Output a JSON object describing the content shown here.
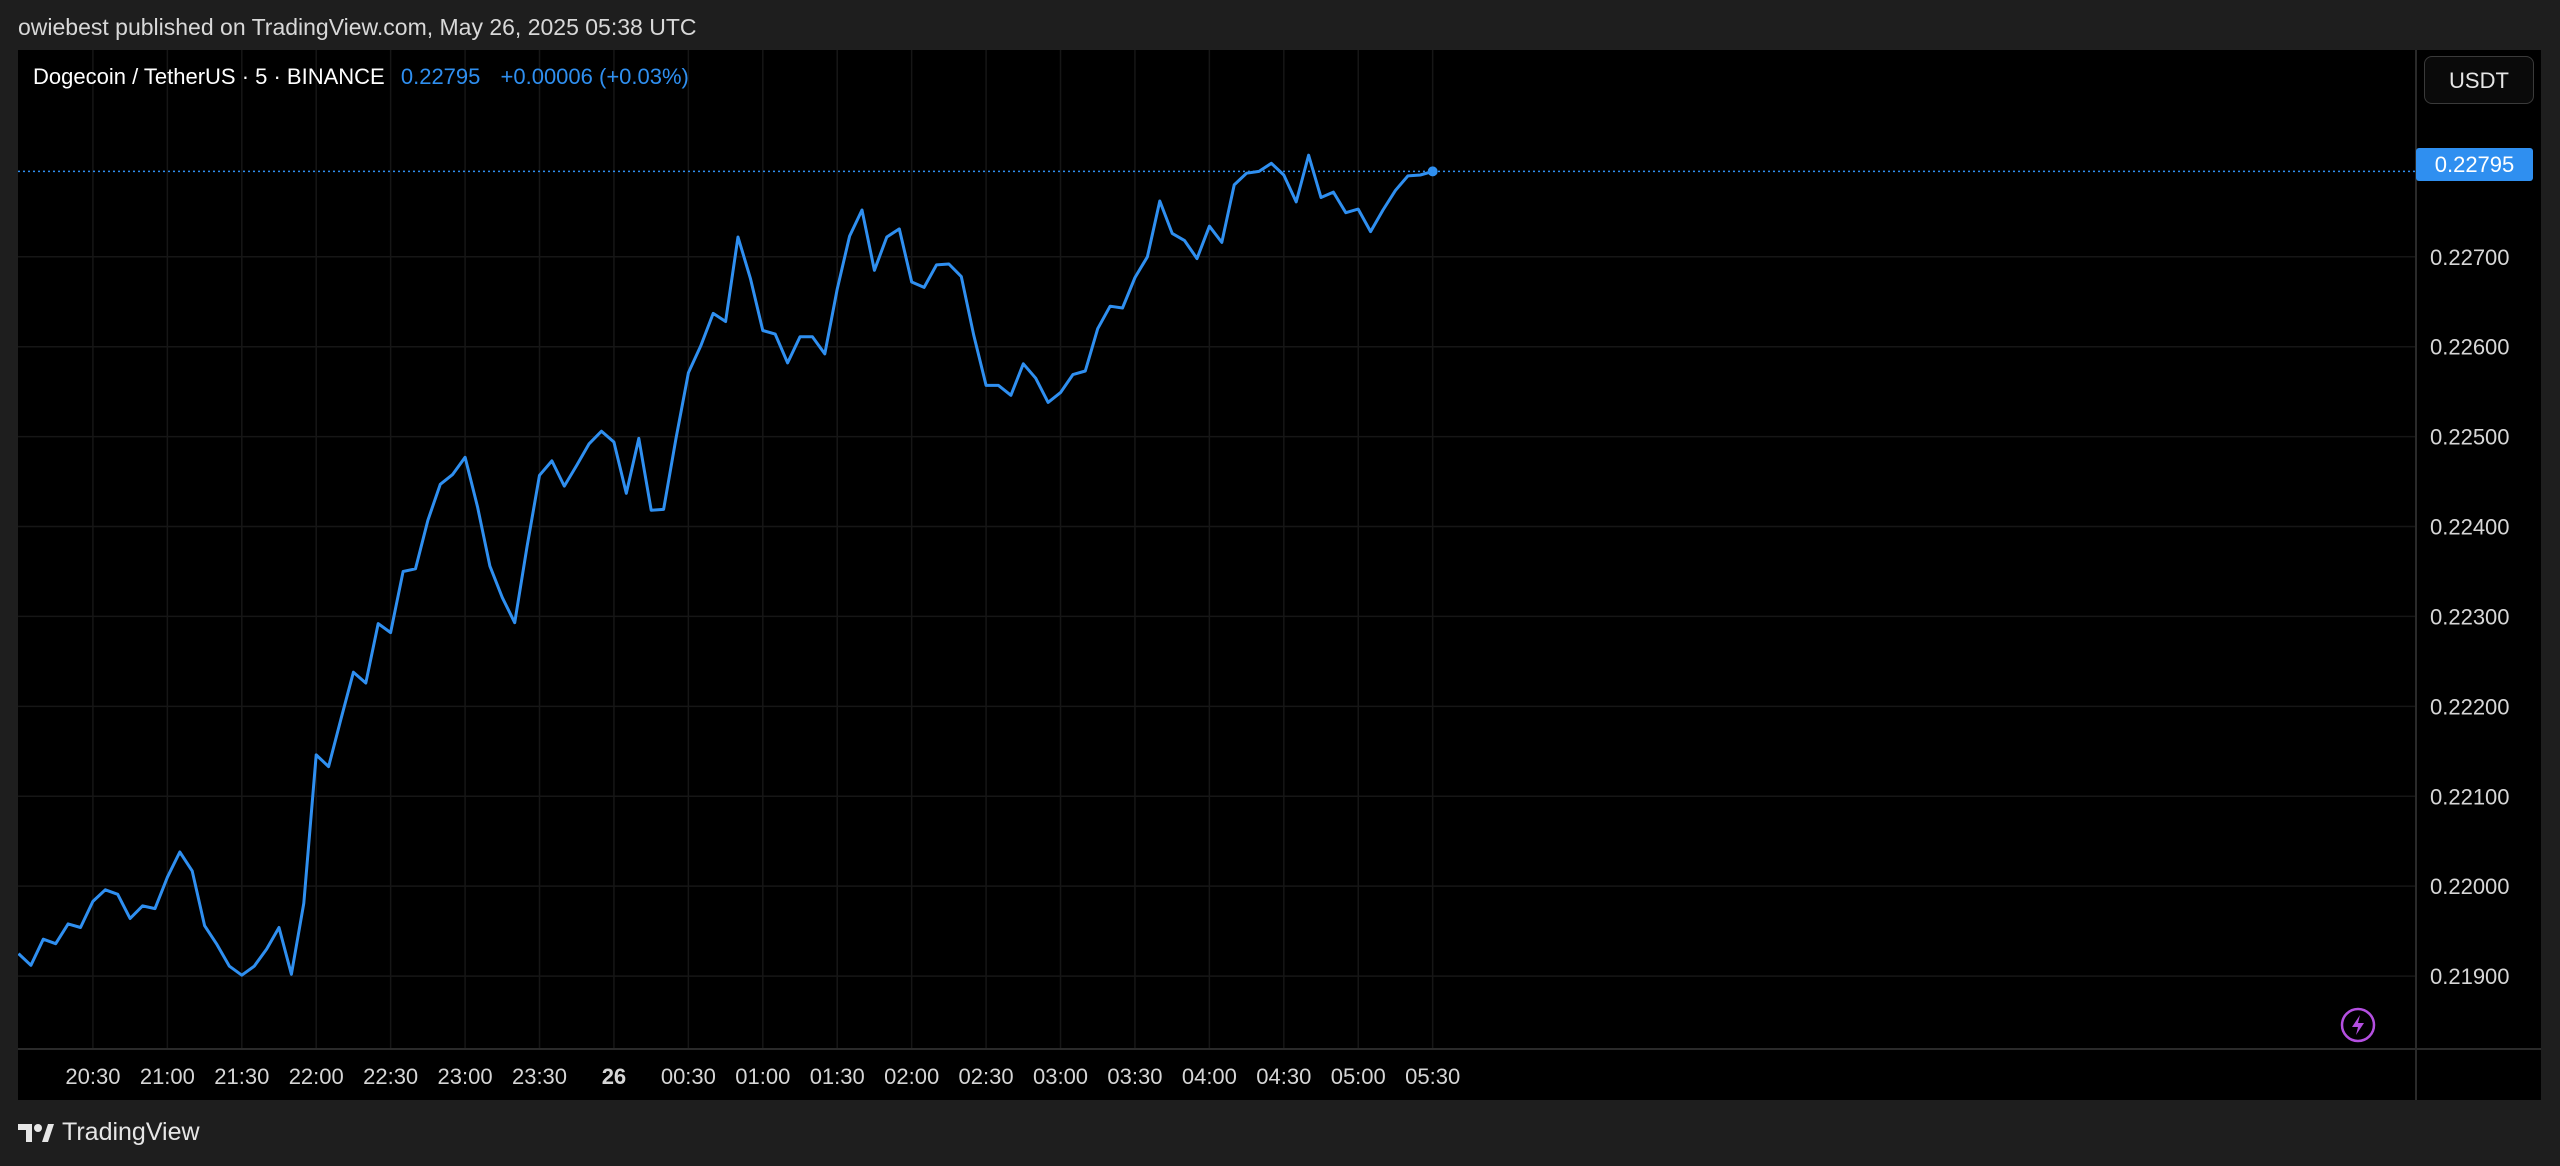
{
  "header": {
    "published_text": "owiebest published on TradingView.com, May 26, 2025 05:38 UTC"
  },
  "legend": {
    "symbol": "Dogecoin / TetherUS · 5 · BINANCE",
    "price": "0.22795",
    "change": "+0.00006 (+0.03%)"
  },
  "currency_button": {
    "label": "USDT"
  },
  "last_price_tag": {
    "label": "0.22795"
  },
  "footer": {
    "brand": "TradingView"
  },
  "colors": {
    "line": "#2f8ff0",
    "background": "#000000",
    "grid": "#161616",
    "axis_text": "#d6d6d6"
  },
  "chart_data": {
    "type": "line",
    "title": "",
    "xlabel": "",
    "ylabel": "",
    "ylim": [
      0.2182,
      0.2293
    ],
    "x_start": "20:00",
    "x_interval_minutes": 5,
    "x_ticks": [
      {
        "label": "20:30",
        "t": 30
      },
      {
        "label": "21:00",
        "t": 60
      },
      {
        "label": "21:30",
        "t": 90
      },
      {
        "label": "22:00",
        "t": 120
      },
      {
        "label": "22:30",
        "t": 150
      },
      {
        "label": "23:00",
        "t": 180
      },
      {
        "label": "23:30",
        "t": 210
      },
      {
        "label": "26",
        "t": 240,
        "bold": true
      },
      {
        "label": "00:30",
        "t": 270
      },
      {
        "label": "01:00",
        "t": 300
      },
      {
        "label": "01:30",
        "t": 330
      },
      {
        "label": "02:00",
        "t": 360
      },
      {
        "label": "02:30",
        "t": 390
      },
      {
        "label": "03:00",
        "t": 420
      },
      {
        "label": "03:30",
        "t": 450
      },
      {
        "label": "04:00",
        "t": 480
      },
      {
        "label": "04:30",
        "t": 510
      },
      {
        "label": "05:00",
        "t": 540
      },
      {
        "label": "05:30",
        "t": 570
      }
    ],
    "y_ticks": [
      "0.22700",
      "0.22600",
      "0.22500",
      "0.22400",
      "0.22300",
      "0.22200",
      "0.22100",
      "0.22000",
      "0.21900"
    ],
    "last_price": 0.22795,
    "series": [
      {
        "name": "",
        "values": [
          0.21925,
          0.21912,
          0.21941,
          0.21936,
          0.21958,
          0.21954,
          0.21983,
          0.21996,
          0.21991,
          0.21964,
          0.21978,
          0.21975,
          0.2201,
          0.22038,
          0.22017,
          0.21956,
          0.21935,
          0.21911,
          0.21901,
          0.21911,
          0.2193,
          0.21954,
          0.21902,
          0.21981,
          0.22146,
          0.22133,
          0.22186,
          0.22238,
          0.22226,
          0.22292,
          0.22282,
          0.2235,
          0.22353,
          0.22407,
          0.22447,
          0.22458,
          0.22477,
          0.22422,
          0.22356,
          0.22321,
          0.22293,
          0.22378,
          0.22457,
          0.22473,
          0.22445,
          0.22468,
          0.22492,
          0.22506,
          0.22494,
          0.22437,
          0.22498,
          0.22418,
          0.22419,
          0.22498,
          0.22571,
          0.22601,
          0.22637,
          0.22628,
          0.22722,
          0.22676,
          0.22618,
          0.22614,
          0.22582,
          0.22611,
          0.22611,
          0.22592,
          0.22664,
          0.22723,
          0.22752,
          0.22685,
          0.22722,
          0.22731,
          0.22672,
          0.22666,
          0.22691,
          0.22692,
          0.22678,
          0.22613,
          0.22557,
          0.22557,
          0.22546,
          0.22581,
          0.22565,
          0.22538,
          0.22549,
          0.22569,
          0.22573,
          0.2262,
          0.22645,
          0.22643,
          0.22677,
          0.227,
          0.22762,
          0.22726,
          0.22718,
          0.22698,
          0.22734,
          0.22716,
          0.2278,
          0.22793,
          0.22795,
          0.22804,
          0.22791,
          0.22761,
          0.22813,
          0.22766,
          0.22772,
          0.22749,
          0.22753,
          0.22728,
          0.22752,
          0.22774,
          0.2279,
          0.22791,
          0.22795
        ]
      }
    ]
  }
}
